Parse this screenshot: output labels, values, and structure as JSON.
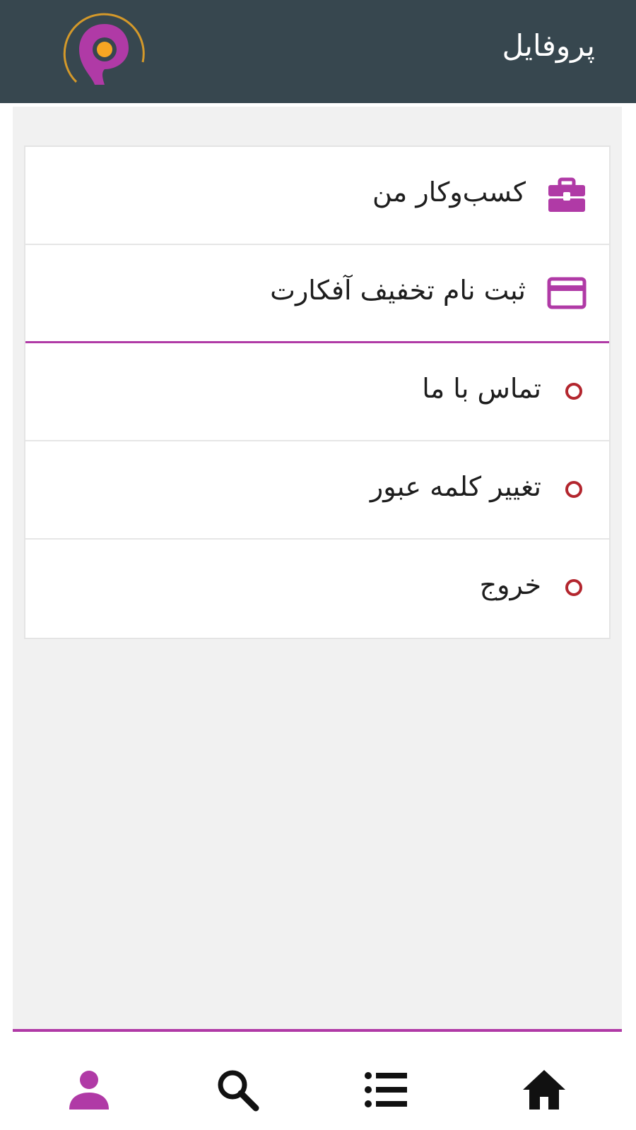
{
  "header": {
    "title": "پروفایل",
    "logo_icon": "location-pin-logo"
  },
  "menu": {
    "items": [
      {
        "label": "کسب‌وکار من",
        "icon": "briefcase-icon"
      },
      {
        "label": "ثبت نام تخفیف آفکارت",
        "icon": "credit-card-icon"
      },
      {
        "label": "تماس با ما",
        "icon": "circle-bullet-icon"
      },
      {
        "label": "تغییر کلمه عبور",
        "icon": "circle-bullet-icon"
      },
      {
        "label": "خروج",
        "icon": "circle-bullet-icon"
      }
    ]
  },
  "bottom_nav": {
    "items": [
      {
        "icon": "user-icon",
        "active": true
      },
      {
        "icon": "search-icon",
        "active": false
      },
      {
        "icon": "list-icon",
        "active": false
      },
      {
        "icon": "home-icon",
        "active": false
      }
    ]
  },
  "colors": {
    "header_bg": "#37474f",
    "accent": "#b03aa6",
    "bullet": "#b3262e",
    "logo_dot": "#f5a623"
  }
}
